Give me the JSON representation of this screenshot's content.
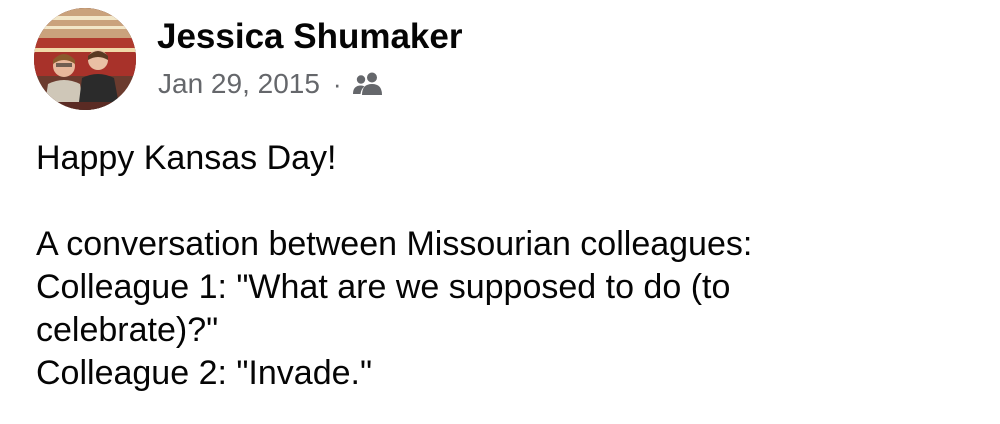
{
  "post": {
    "author": "Jessica Shumaker",
    "date": "Jan 29, 2015",
    "separator": "·",
    "audience_icon": "friends-icon",
    "lines": [
      "Happy Kansas Day!",
      "",
      "A conversation between Missourian colleagues:",
      "Colleague 1: \"What are we supposed to do (to",
      "celebrate)?\"",
      "Colleague 2: \"Invade.\""
    ]
  }
}
